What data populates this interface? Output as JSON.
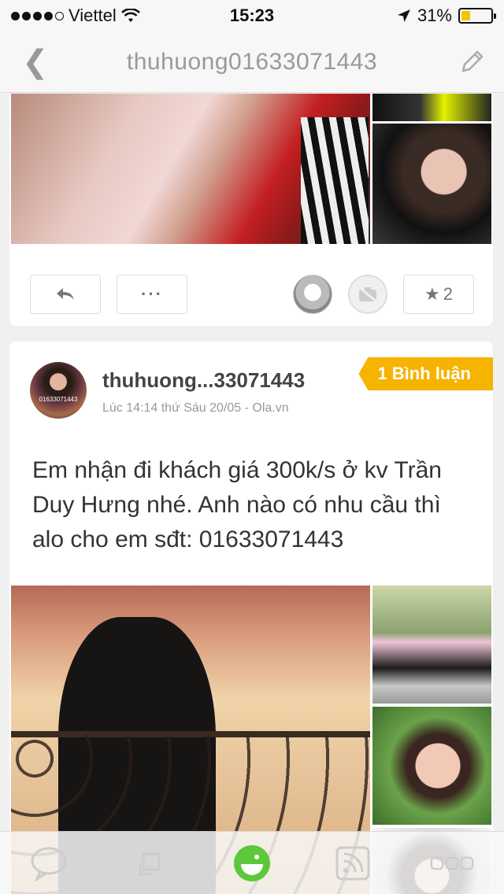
{
  "status_bar": {
    "carrier": "Viettel",
    "time": "15:23",
    "battery": "31%",
    "battery_level": 0.31,
    "signal_bars": 4
  },
  "nav": {
    "title": "thuhuong01633071443",
    "back_icon": "chevron-left-icon",
    "edit_icon": "pencil-icon"
  },
  "post1": {
    "actions": {
      "reply_icon": "reply-icon",
      "more_label": "···",
      "star_count": "2"
    }
  },
  "post2": {
    "username": "thuhuong...33071443",
    "meta": "Lúc 14:14 thứ Sáu 20/05 - Ola.vn",
    "comment_badge": "1 Bình luận",
    "avatar_caption": "01633071443",
    "text": "Em nhận đi khách giá 300k/s ở kv Trần Duy Hưng nhé. Anh nào có nhu cầu thì alo cho em sđt: 01633071443"
  },
  "tab_bar": {
    "tabs": [
      "chat-icon",
      "cards-icon",
      "home-face-icon",
      "feed-icon",
      "menu-icon"
    ],
    "accent": "#5cc83a"
  },
  "colors": {
    "badge": "#f6b300",
    "battery": "#f5c400"
  }
}
